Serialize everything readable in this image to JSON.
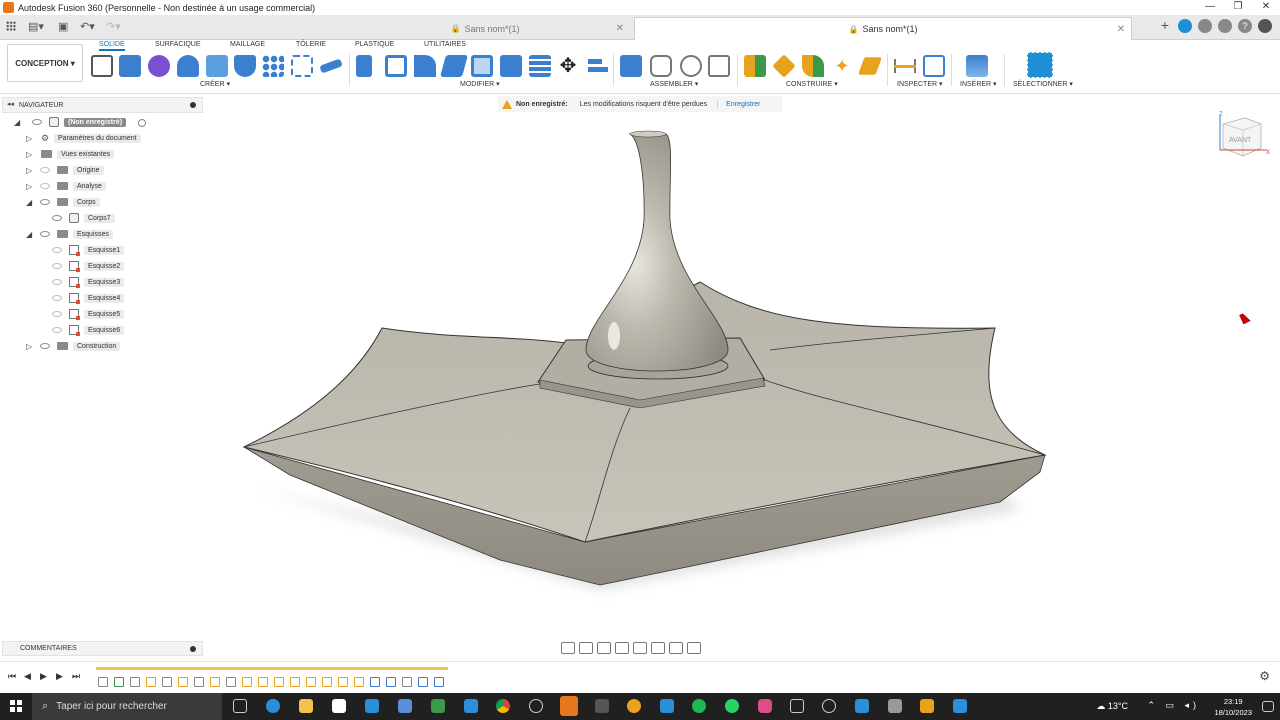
{
  "window": {
    "title": "Autodesk Fusion 360 (Personnelle - Non destinée à un usage commercial)",
    "controls": [
      "—",
      "❐",
      "✕"
    ]
  },
  "tabs": [
    {
      "label": "Sans nom*(1)",
      "active": false
    },
    {
      "label": "Sans nom*(1)",
      "active": true
    }
  ],
  "toolbar": {
    "workspace": "CONCEPTION ▾",
    "ribbon_tabs": [
      "SOLIDE",
      "SURFACIQUE",
      "MAILLAGE",
      "TÔLERIE",
      "PLASTIQUE",
      "UTILITAIRES"
    ],
    "groups": [
      "CRÉER ▾",
      "MODIFIER ▾",
      "ASSEMBLER ▾",
      "CONSTRUIRE ▾",
      "INSPECTER ▾",
      "INSÉRER ▾",
      "SÉLECTIONNER ▾"
    ],
    "accent": "#0d74c1"
  },
  "navigator": {
    "title": "NAVIGATEUR",
    "root": "(Non enregistré)",
    "items": [
      {
        "label": "Paramètres du document"
      },
      {
        "label": "Vues existantes"
      },
      {
        "label": "Origine"
      },
      {
        "label": "Analyse"
      },
      {
        "label": "Corps"
      },
      {
        "label": "Corps7"
      },
      {
        "label": "Esquisses"
      },
      {
        "label": "Esquisse1"
      },
      {
        "label": "Esquisse2"
      },
      {
        "label": "Esquisse3"
      },
      {
        "label": "Esquisse4"
      },
      {
        "label": "Esquisse5"
      },
      {
        "label": "Esquisse6"
      },
      {
        "label": "Construction"
      }
    ]
  },
  "warning": {
    "title": "Non enregistré:",
    "message": "Les modifications risquent d'être perdues",
    "action": "Enregistrer"
  },
  "viewcube": {
    "label": "AVANT",
    "axis_z": "Z",
    "axis_x": "X"
  },
  "comments": {
    "title": "COMMENTAIRES"
  },
  "taskbar": {
    "search_placeholder": "Taper ici pour rechercher",
    "weather": "13°C",
    "time": "23:19",
    "date": "18/10/2023"
  }
}
